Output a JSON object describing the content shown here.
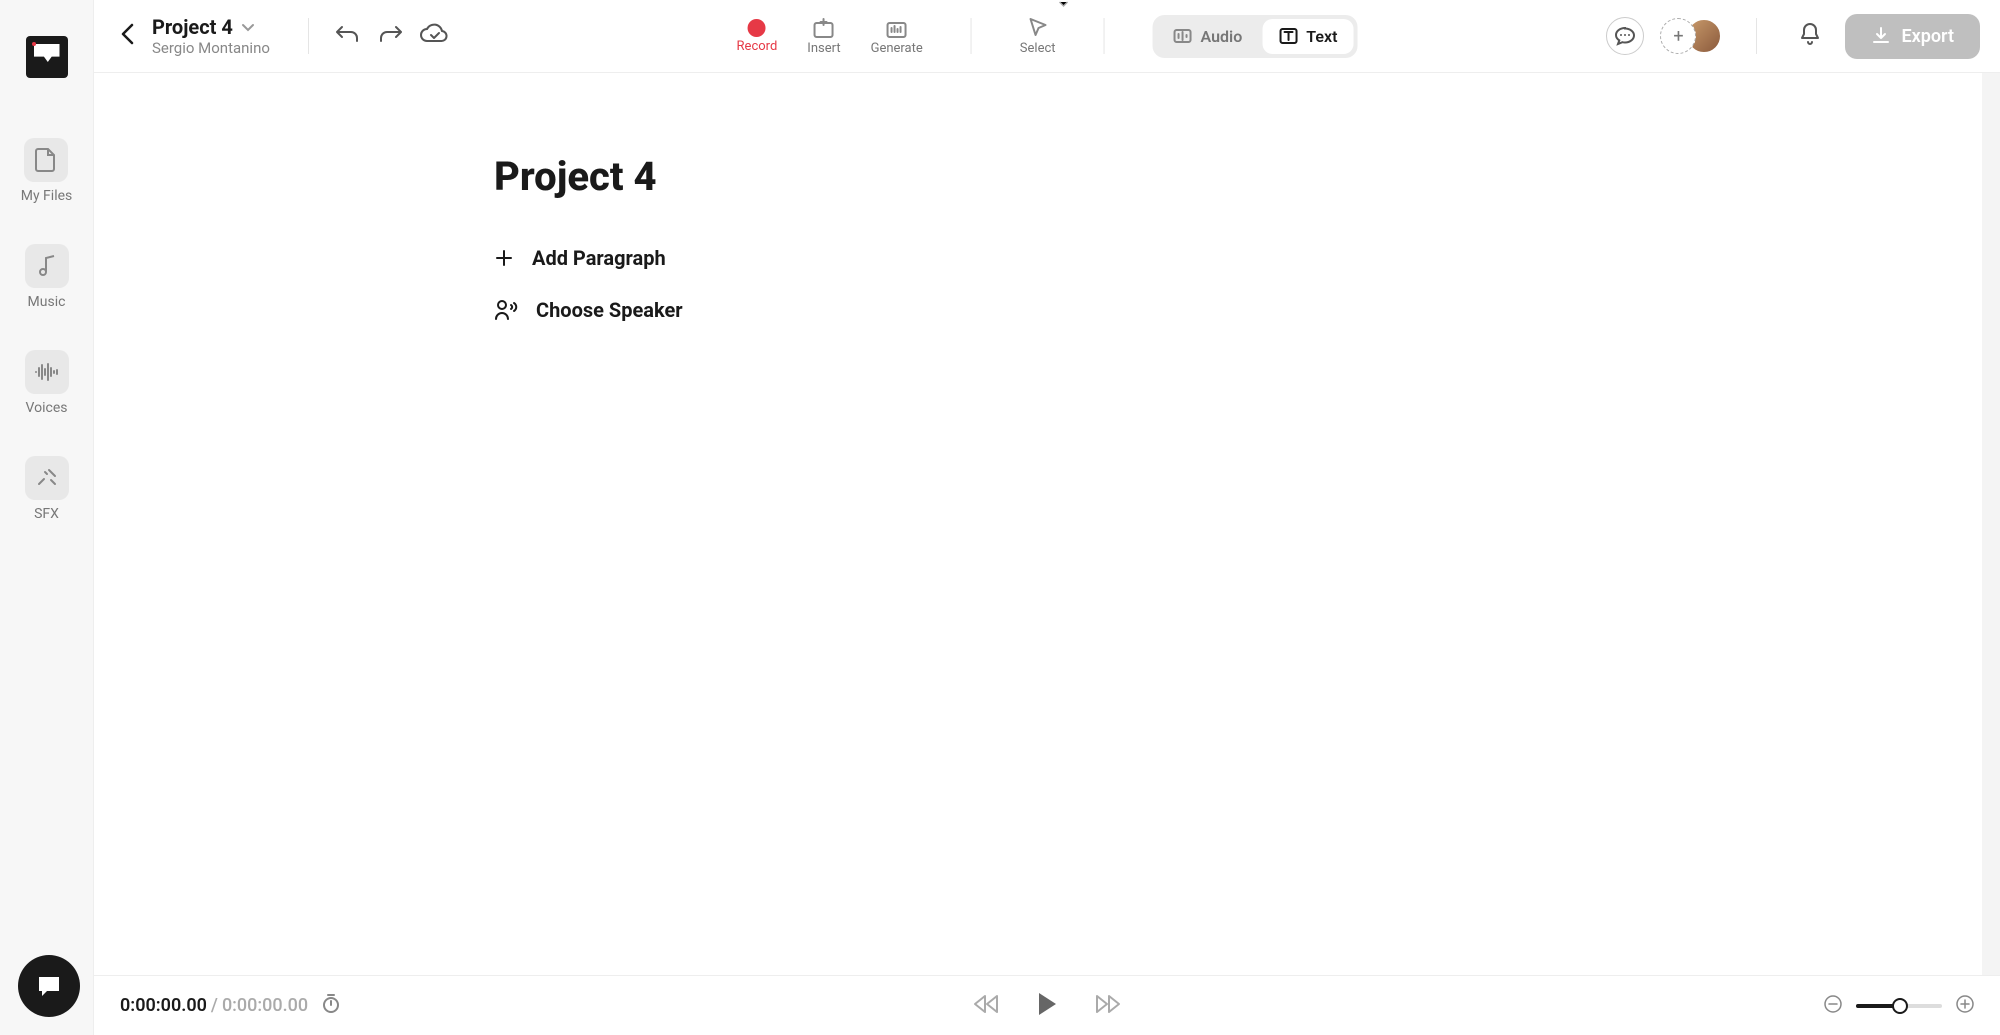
{
  "header": {
    "project_title": "Project 4",
    "author": "Sergio Montanino",
    "tools": {
      "record": "Record",
      "insert": "Insert",
      "generate": "Generate",
      "select": "Select"
    },
    "mode_toggle": {
      "audio": "Audio",
      "text": "Text"
    },
    "export_label": "Export"
  },
  "sidebar": {
    "items": [
      {
        "label": "My Files"
      },
      {
        "label": "Music"
      },
      {
        "label": "Voices"
      },
      {
        "label": "SFX"
      }
    ]
  },
  "document": {
    "title": "Project 4",
    "actions": {
      "add_paragraph": "Add Paragraph",
      "choose_speaker": "Choose Speaker"
    }
  },
  "player": {
    "current_time": "0:00:00.00",
    "separator": "/",
    "total_time": "0:00:00.00"
  },
  "colors": {
    "accent_red": "#e63946",
    "text_dark": "#1a1a1a",
    "text_muted": "#888"
  }
}
